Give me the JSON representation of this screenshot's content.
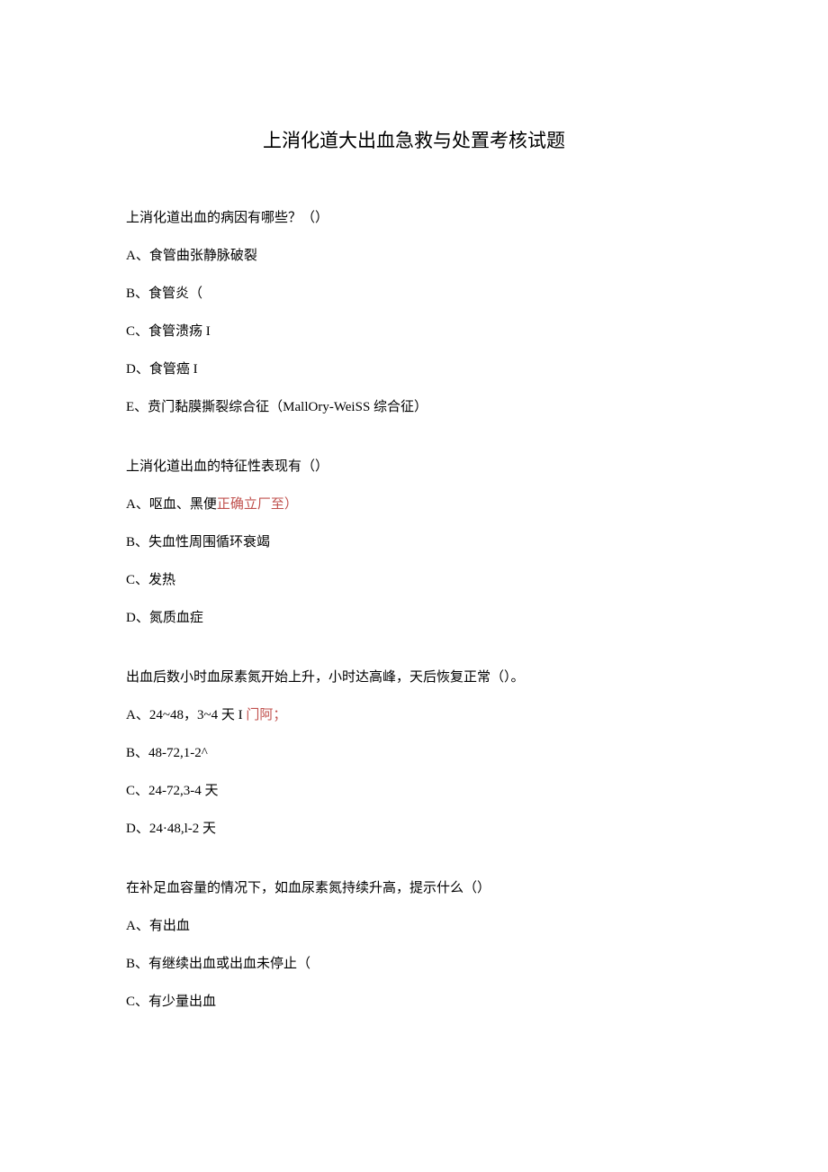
{
  "title": "上消化道大出血急救与处置考核试题",
  "questions": [
    {
      "stem": "上消化道出血的病因有哪些？（）",
      "options": [
        {
          "label": "A、食管曲张静脉破裂"
        },
        {
          "label": "B、食管炎（"
        },
        {
          "label": "C、食管溃疡 I"
        },
        {
          "label": "D、食管癌 I"
        },
        {
          "label": "E、贲门黏膜撕裂综合征（MallOry-WeiSS 综合征）"
        }
      ]
    },
    {
      "stem": "上消化道出血的特征性表现有（）",
      "options": [
        {
          "label": "A、呕血、黑便",
          "hint": "正确立厂至）"
        },
        {
          "label": "B、失血性周围循环衰竭"
        },
        {
          "label": "C、发热"
        },
        {
          "label": "D、氮质血症"
        }
      ]
    },
    {
      "stem": "出血后数小时血尿素氮开始上升，小时达高峰，天后恢复正常（）。",
      "options": [
        {
          "label": "A、24~48，3~4 天 I",
          "hint": " 门阿；"
        },
        {
          "label": "B、48-72,1-2^"
        },
        {
          "label": "C、24-72,3-4 天"
        },
        {
          "label": "D、24·48,l-2 天"
        }
      ]
    },
    {
      "stem": "在补足血容量的情况下，如血尿素氮持续升高，提示什么（）",
      "options": [
        {
          "label": "A、有出血"
        },
        {
          "label": "B、有继续出血或出血未停止（"
        },
        {
          "label": "C、有少量出血"
        }
      ]
    }
  ]
}
